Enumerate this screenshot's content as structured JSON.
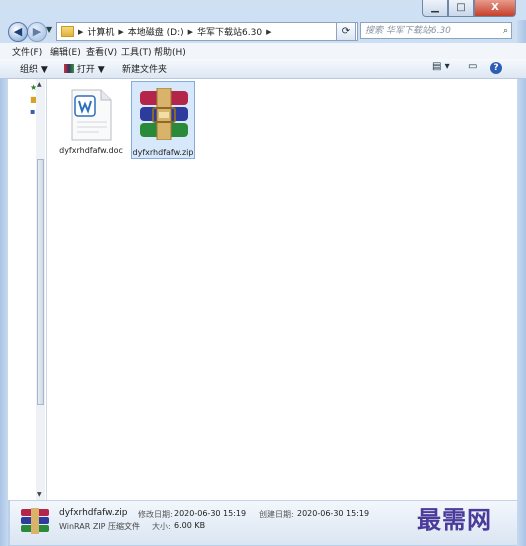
{
  "window": {
    "min_icon": "minimize-icon",
    "max_icon": "maximize-icon",
    "close_label": "X"
  },
  "nav": {
    "back": "◀",
    "forward": "▶"
  },
  "address": {
    "crumbs": [
      "计算机",
      "本地磁盘 (D:)",
      "华军下载站6.30"
    ],
    "search_placeholder": "搜索 华军下载站6.30"
  },
  "menu": [
    "文件(F)",
    "编辑(E)",
    "查看(V)",
    "工具(T)",
    "帮助(H)"
  ],
  "toolbar": {
    "organize": "组织 ▼",
    "open": "打开 ▼",
    "new_folder": "新建文件夹"
  },
  "files": [
    {
      "name": "dyfxrhdfafw.doc",
      "icon": "word-document-icon",
      "selected": false
    },
    {
      "name": "dyfxrhdfafw.zip",
      "icon": "winrar-archive-icon",
      "selected": true
    }
  ],
  "details": {
    "filename": "dyfxrhdfafw.zip",
    "type": "WinRAR ZIP 压缩文件",
    "modified_label": "修改日期:",
    "modified": "2020-06-30 15:19",
    "size_label": "大小:",
    "size": "6.00 KB",
    "created_label": "创建日期:",
    "created": "2020-06-30 15:19"
  },
  "watermark": "最需网",
  "colors": {
    "selection": "#d7e8fb",
    "frame": "#b8d0ec",
    "close": "#c6402b"
  }
}
